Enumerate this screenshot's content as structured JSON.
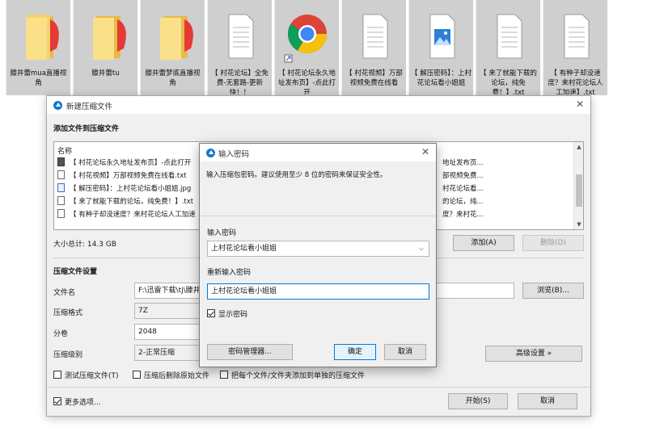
{
  "desktop": {
    "icons": [
      {
        "label": "滕井蕾mua直播视角",
        "type": "folder"
      },
      {
        "label": "滕井蕾tu",
        "type": "folder"
      },
      {
        "label": "滕井蕾梦底直播视角",
        "type": "folder"
      },
      {
        "label": "【 村花论坛】全免费-无套路-更新快！！",
        "type": "text"
      },
      {
        "label": "【 村花论坛永久地址发布页】-点此打开",
        "type": "chrome"
      },
      {
        "label": "【 村花视频】万部视频免费在线看",
        "type": "text"
      },
      {
        "label": "【 解压密码】：上村花论坛看小姐姐",
        "type": "image"
      },
      {
        "label": "【 来了就能下载的论坛，纯免费！】.txt",
        "type": "text"
      },
      {
        "label": "【 有种子却没速度？来村花论坛人工加速】.txt",
        "type": "text"
      }
    ]
  },
  "main_window": {
    "title": "新建压缩文件",
    "section_add": "添加文件到压缩文件",
    "list_header": "名称",
    "files": [
      {
        "name": "【 村花论坛永久地址发布页】-点此打开",
        "icon": "link-icon",
        "right": "地址发布页..."
      },
      {
        "name": "【 村花视频】万部视频免费在线看.txt",
        "icon": "txt-icon",
        "right": "部视频免费..."
      },
      {
        "name": "【 解压密码】：上村花论坛看小姐姐.jpg",
        "icon": "image-icon",
        "right": "村花论坛看..."
      },
      {
        "name": "【 来了就能下载的论坛，纯免费！】.txt",
        "icon": "txt-icon",
        "right": "的论坛，纯..."
      },
      {
        "name": "【 有种子却没速度？来村花论坛人工加速",
        "icon": "txt-icon",
        "right": "度？来村花..."
      }
    ],
    "total_size": "大小总计: 14.3 GB",
    "add_button": "添加(A)",
    "delete_button": "删除(D)",
    "settings_title": "压缩文件设置",
    "filename_label": "文件名",
    "filename_value": "F:\\迅雷下载\\tj\\滕井",
    "browse_button": "浏览(B)...",
    "format_label": "压缩格式",
    "format_value": "7Z",
    "split_label": "分卷",
    "split_value": "2048",
    "level_label": "压缩级别",
    "level_value": "2-正常压缩",
    "advanced_button": "高级设置 »",
    "check_test": "测试压缩文件(T)",
    "check_delete": "压缩后删除原始文件",
    "check_each": "把每个文件/文件夹添加到单独的压缩文件",
    "more_options": "更多选项...",
    "start_button": "开始(S)",
    "cancel_button": "取消"
  },
  "password_dialog": {
    "title": "输入密码",
    "hint": "输入压缩包密码。建议使用至少 8 位的密码来保证安全性。",
    "enter_label": "输入密码",
    "enter_value": "上村花论坛看小姐姐",
    "reenter_label": "重新输入密码",
    "reenter_value": "上村花论坛看小姐姐",
    "show_password": "显示密码",
    "show_password_checked": true,
    "manager_button": "密码管理器...",
    "ok_button": "确定",
    "cancel_button": "取消"
  }
}
